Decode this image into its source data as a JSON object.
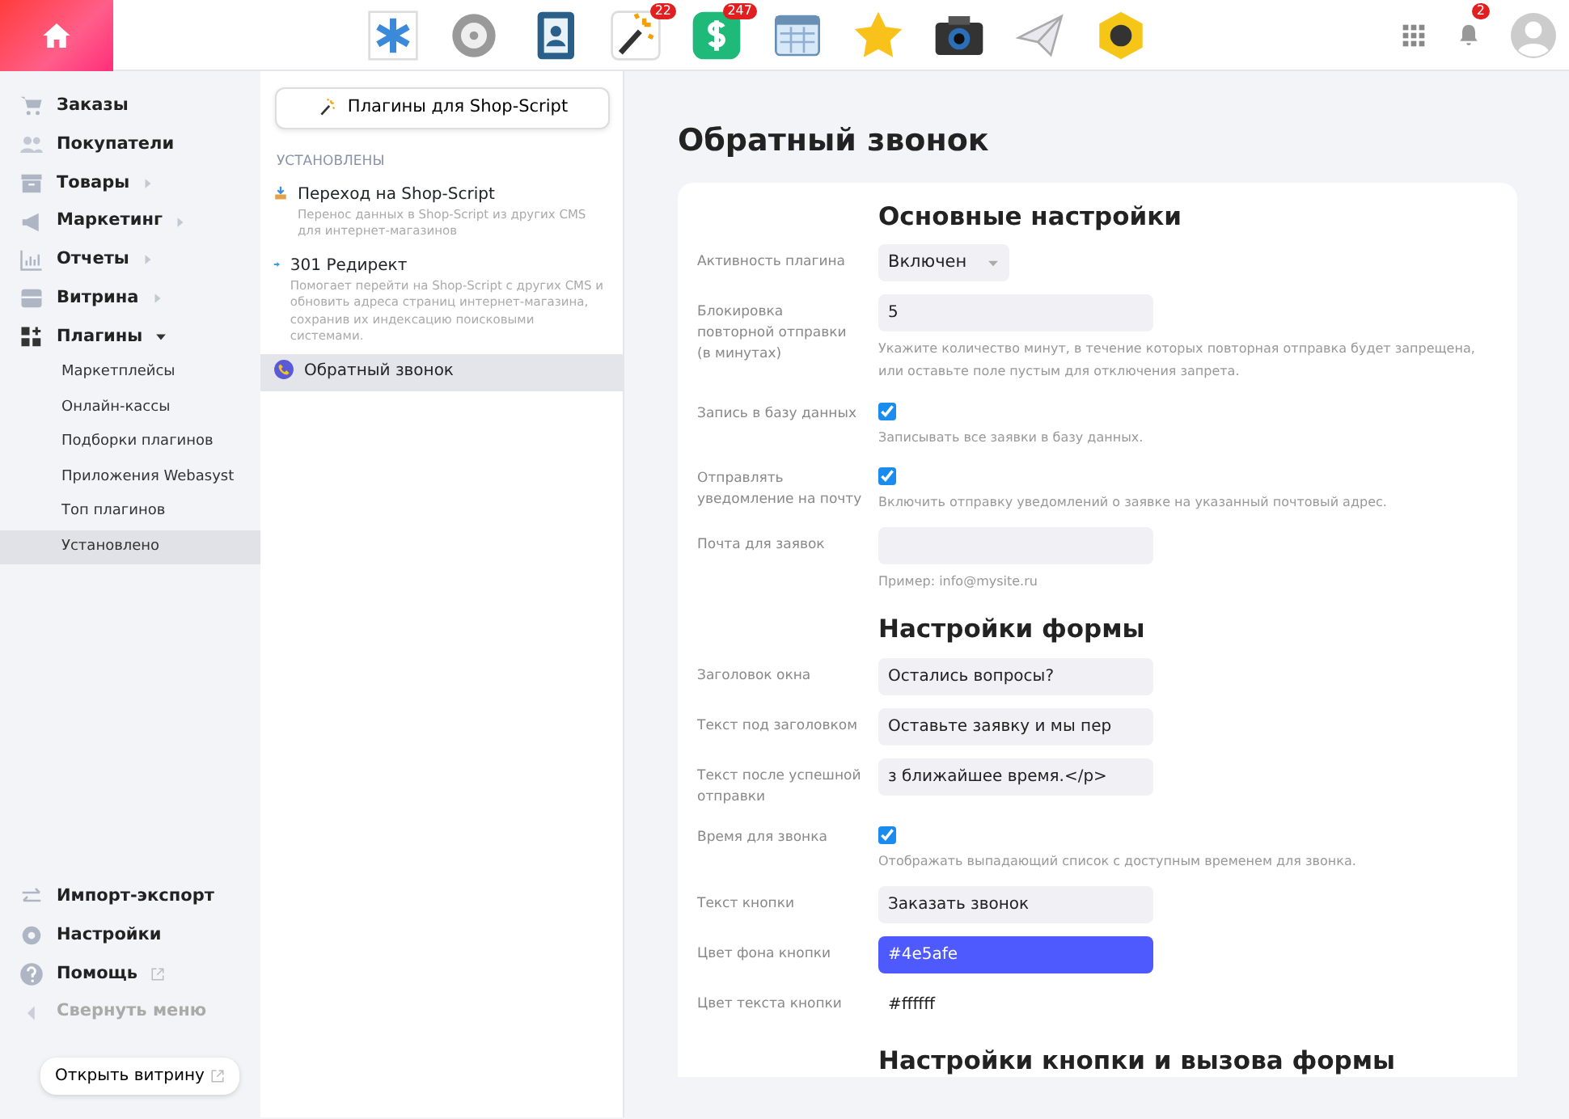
{
  "topbar": {
    "apps": [
      {
        "kind": "asterisk"
      },
      {
        "kind": "gear"
      },
      {
        "kind": "contacts"
      },
      {
        "kind": "wand",
        "badge": "22"
      },
      {
        "kind": "dollar",
        "badge": "247"
      },
      {
        "kind": "calendar"
      },
      {
        "kind": "star"
      },
      {
        "kind": "camera"
      },
      {
        "kind": "plane"
      },
      {
        "kind": "hexagon"
      }
    ],
    "notifications_badge": "2"
  },
  "sidebar": {
    "items": [
      {
        "label": "Заказы"
      },
      {
        "label": "Покупатели"
      },
      {
        "label": "Товары",
        "expanded": false
      },
      {
        "label": "Маркетинг",
        "expanded": false
      },
      {
        "label": "Отчеты",
        "expanded": false
      },
      {
        "label": "Витрина",
        "expanded": false
      },
      {
        "label": "Плагины",
        "expanded": true,
        "children": [
          {
            "label": "Маркетплейсы",
            "selected": false
          },
          {
            "label": "Онлайн-кассы",
            "selected": false
          },
          {
            "label": "Подборки плагинов",
            "selected": false
          },
          {
            "label": "Приложения Webasyst",
            "selected": false
          },
          {
            "label": "Топ плагинов",
            "selected": false
          },
          {
            "label": "Установлено",
            "selected": true
          }
        ]
      }
    ],
    "bottom_items": [
      {
        "label": "Импорт-экспорт",
        "external": false,
        "muted": false
      },
      {
        "label": "Настройки",
        "external": false,
        "muted": false
      },
      {
        "label": "Помощь",
        "external": true,
        "muted": false
      },
      {
        "label": "Свернуть меню",
        "external": false,
        "muted": true
      }
    ],
    "storefront_button": "Открыть витрину"
  },
  "plugins_panel": {
    "button": "Плагины для Shop-Script",
    "section_label": "УСТАНОВЛЕНЫ",
    "items": [
      {
        "title": "Переход на Shop-Script",
        "description": "Перенос данных в Shop-Script из других CMS для интернет-магазинов",
        "selected": false
      },
      {
        "title": "301 Редирект",
        "description": "Помогает перейти на Shop-Script с других CMS и обновить адреса страниц интернет-магазина, сохранив их индексацию поисковыми системами.",
        "selected": false
      },
      {
        "title": "Обратный звонок",
        "selected": true
      }
    ]
  },
  "page_title": "Обратный звонок",
  "sections": [
    {
      "heading": "Основные настройки",
      "fields": [
        {
          "label": "Активность плагина",
          "kind": "select",
          "value": "Включен"
        },
        {
          "label": "Блокировка повторной отправки (в минутах)",
          "kind": "text",
          "value": "5",
          "hint": "Укажите количество минут, в течение которых повторная отправка будет запрещена, или оставьте поле пустым для отключения запрета."
        },
        {
          "label": "Запись в базу данных",
          "kind": "checkbox",
          "checked": true,
          "hint": "Записывать все заявки в базу данных."
        },
        {
          "label": "Отправлять уведомление на почту",
          "kind": "checkbox",
          "checked": true,
          "hint": "Включить отправку уведомлений о заявке на указанный почтовый адрес."
        },
        {
          "label": "Почта для заявок",
          "kind": "text",
          "hint": "Пример: info@mysite.ru"
        }
      ]
    },
    {
      "heading": "Настройки формы",
      "fields": [
        {
          "label": "Заголовок окна",
          "kind": "text",
          "value": "Остались вопросы?"
        },
        {
          "label": "Текст под заголовком",
          "kind": "text",
          "value": "Оставьте заявку и мы пер"
        },
        {
          "label": "Текст после успешной отправки",
          "kind": "text",
          "value": "з ближайшее время.</p>"
        },
        {
          "label": "Время для звонка",
          "kind": "checkbox",
          "checked": true,
          "hint": "Отображать выпадающий список с доступным временем для звонка."
        },
        {
          "label": "Текст кнопки",
          "kind": "text",
          "value": "Заказать звонок"
        },
        {
          "label": "Цвет фона кнопки",
          "kind": "color",
          "value": "#4e5afe"
        },
        {
          "label": "Цвет текста кнопки",
          "kind": "color",
          "value": "#ffffff"
        }
      ]
    },
    {
      "heading": "Настройки кнопки и вызова формы"
    }
  ]
}
